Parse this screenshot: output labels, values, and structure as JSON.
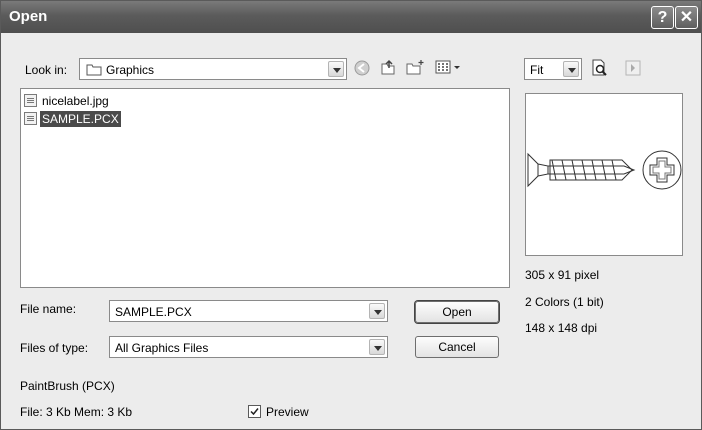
{
  "window": {
    "title": "Open"
  },
  "look_in": {
    "label": "Look in:",
    "value": "Graphics"
  },
  "preview_zoom": {
    "value": "Fit"
  },
  "file_list": [
    {
      "name": "nicelabel.jpg",
      "selected": false
    },
    {
      "name": "SAMPLE.PCX",
      "selected": true
    }
  ],
  "file_name": {
    "label": "File name:",
    "value": "SAMPLE.PCX"
  },
  "file_type": {
    "label": "Files of type:",
    "value": "All Graphics Files"
  },
  "buttons": {
    "open": "Open",
    "cancel": "Cancel"
  },
  "preview_info": {
    "size": "305 x 91 pixel",
    "colors": "2 Colors (1 bit)",
    "dpi": "148 x 148 dpi"
  },
  "status": {
    "format": "PaintBrush (PCX)",
    "file_mem": "File: 3 Kb  Mem: 3 Kb",
    "preview_label": "Preview",
    "preview_checked": true
  }
}
